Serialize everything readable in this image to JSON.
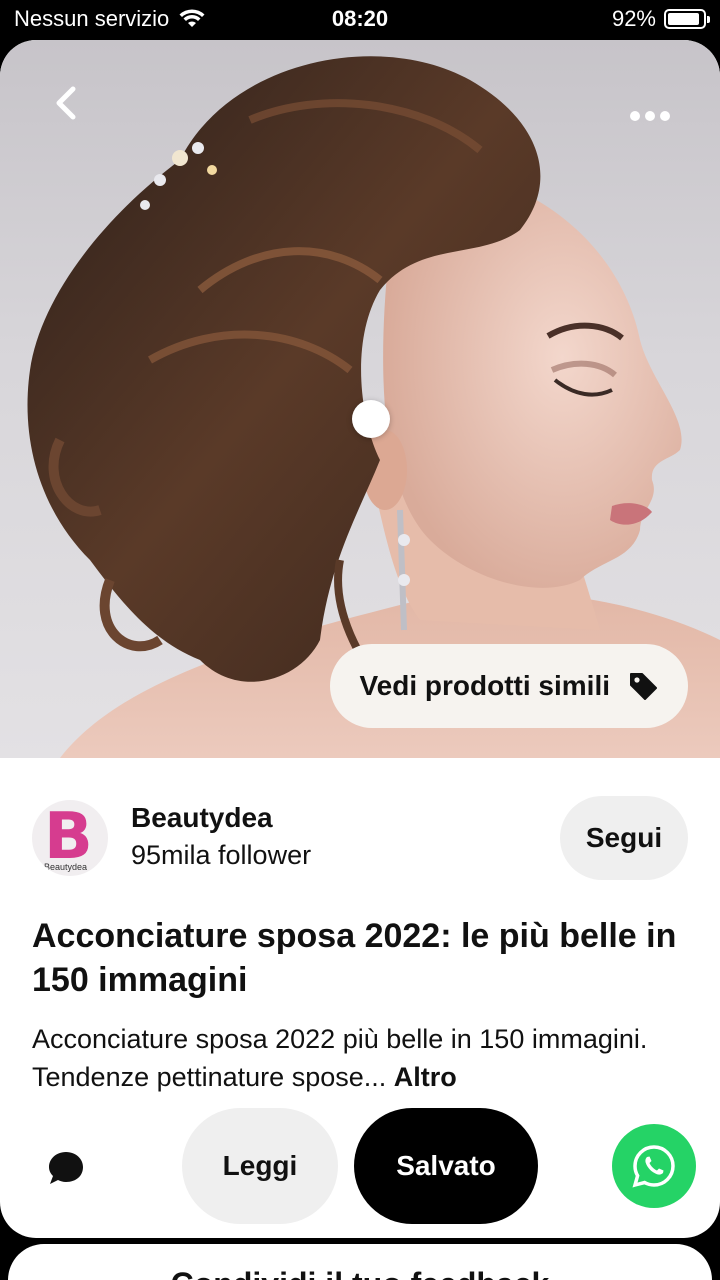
{
  "status_bar": {
    "carrier": "Nessun servizio",
    "time": "08:20",
    "battery_percent_label": "92%",
    "battery_level": 0.92
  },
  "hero": {
    "similar_products_label": "Vedi prodotti simili",
    "icons": {
      "back": "chevron-left-icon",
      "more": "more-horizontal-icon",
      "tag": "tag-icon"
    }
  },
  "profile": {
    "avatar_letter": "B",
    "avatar_subtext": "Beautydea",
    "name": "Beautydea",
    "followers": "95mila follower",
    "follow_label": "Segui"
  },
  "pin": {
    "title": "Acconciature sposa 2022: le più belle in 150 immagini",
    "description": "Acconciature sposa 2022 più belle in 150 immagini. Tendenze pettinature spose... ",
    "more_label": "Altro"
  },
  "actions": {
    "read_label": "Leggi",
    "saved_label": "Salvato",
    "icons": {
      "comment": "comment-icon",
      "share": "whatsapp-icon"
    }
  },
  "next_card": {
    "title_partial": "Condividi il tuo feedback"
  },
  "colors": {
    "saved_button_bg": "#000000",
    "follow_button_bg": "#efefef",
    "whatsapp": "#25d366",
    "avatar_brand": "#d63c8f"
  }
}
